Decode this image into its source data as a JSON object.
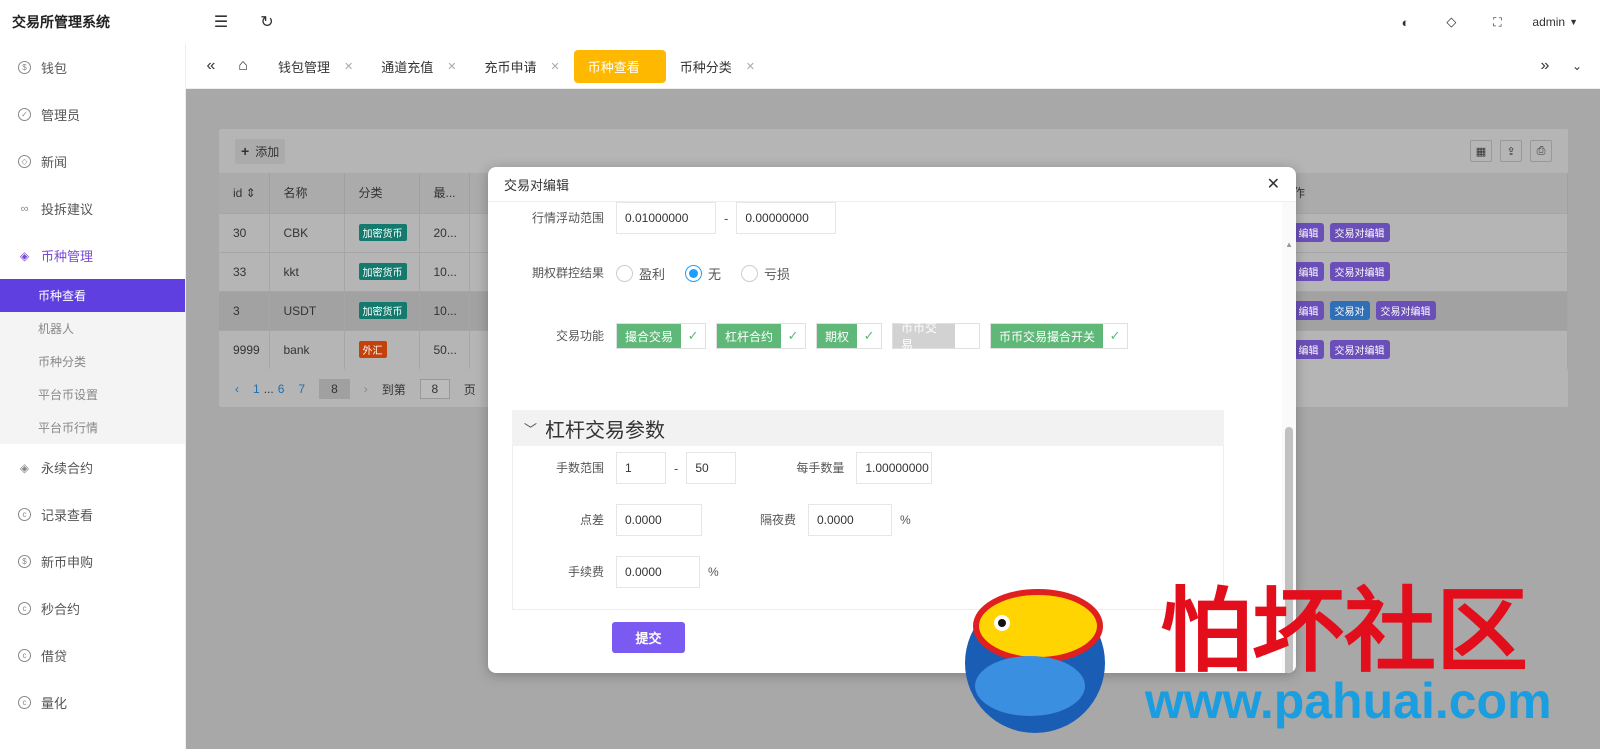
{
  "app": {
    "title": "交易所管理系统",
    "user": "admin"
  },
  "topbar": {
    "icons": [
      "menu-fold-icon",
      "refresh-icon",
      "palette-icon",
      "tag-icon",
      "fullscreen-icon"
    ]
  },
  "tabs": [
    {
      "label": "钱包管理",
      "active": false
    },
    {
      "label": "通道充值",
      "active": false
    },
    {
      "label": "充币申请",
      "active": false
    },
    {
      "label": "币种查看",
      "active": true
    },
    {
      "label": "币种分类",
      "active": false
    }
  ],
  "sidebar": {
    "items": [
      {
        "label": "钱包",
        "icon": "dollar-icon"
      },
      {
        "label": "管理员",
        "icon": "shield-icon"
      },
      {
        "label": "新闻",
        "icon": "tag-icon"
      },
      {
        "label": "投拆建议",
        "icon": "link-icon"
      },
      {
        "label": "币种管理",
        "icon": "diamond-icon"
      },
      {
        "label": "永续合约",
        "icon": "diamond-icon"
      },
      {
        "label": "记录查看",
        "icon": "coin-icon"
      },
      {
        "label": "新币申购",
        "icon": "dollar-icon"
      },
      {
        "label": "秒合约",
        "icon": "coin-icon"
      },
      {
        "label": "借贷",
        "icon": "coin-icon"
      },
      {
        "label": "量化",
        "icon": "coin-icon"
      }
    ],
    "subitems": [
      {
        "label": "币种查看",
        "active": true
      },
      {
        "label": "机器人",
        "active": false
      },
      {
        "label": "币种分类",
        "active": false
      },
      {
        "label": "平台币设置",
        "active": false
      },
      {
        "label": "平台币行情",
        "active": false
      }
    ]
  },
  "table": {
    "add_label": "添加",
    "headers": [
      "id",
      "名称",
      "分类",
      "最..."
    ],
    "op_header": "作",
    "rows": [
      {
        "id": "30",
        "name": "CBK",
        "cat": "加密货币",
        "val": "20...",
        "ops": [
          "编辑",
          "交易对编辑"
        ]
      },
      {
        "id": "33",
        "name": "kkt",
        "cat": "加密货币",
        "val": "10...",
        "ops": [
          "编辑",
          "交易对编辑"
        ]
      },
      {
        "id": "3",
        "name": "USDT",
        "cat": "加密货币",
        "val": "10...",
        "ops": [
          "编辑",
          "交易对",
          "交易对编辑"
        ]
      },
      {
        "id": "9999",
        "name": "bank",
        "cat": "外汇",
        "val": "50...",
        "ops": [
          "编辑",
          "交易对编辑"
        ]
      }
    ],
    "pager": {
      "p1": "1",
      "ellipsis": "...",
      "p6": "6",
      "p7": "7",
      "current": "8",
      "goto": "到第",
      "goto_value": "8",
      "page": "页"
    }
  },
  "modal": {
    "title": "交易对编辑",
    "fluct_label": "行情浮动范围",
    "fluct_min": "0.01000000",
    "fluct_max": "0.00000000",
    "option_label": "期权群控结果",
    "radios": [
      {
        "label": "盈利",
        "checked": false
      },
      {
        "label": "无",
        "checked": true
      },
      {
        "label": "亏损",
        "checked": false
      }
    ],
    "func_label": "交易功能",
    "checks": [
      {
        "label": "撮合交易",
        "on": true
      },
      {
        "label": "杠杆合约",
        "on": true
      },
      {
        "label": "期权",
        "on": true
      },
      {
        "label": "币币交易",
        "on": false
      },
      {
        "label": "币币交易撮合开关",
        "on": true
      }
    ],
    "section_title": "杠杆交易参数",
    "lots_label": "手数范围",
    "lots_min": "1",
    "lots_max": "50",
    "per_lot_label": "每手数量",
    "per_lot": "1.00000000",
    "spread_label": "点差",
    "spread": "0.0000",
    "overnight_label": "隔夜费",
    "overnight": "0.0000",
    "fee_label": "手续费",
    "fee": "0.0000",
    "percent": "%",
    "submit": "提交",
    "dash": "-"
  },
  "watermark": {
    "text": "怕坏社区",
    "url": "www.pahuai.com"
  }
}
